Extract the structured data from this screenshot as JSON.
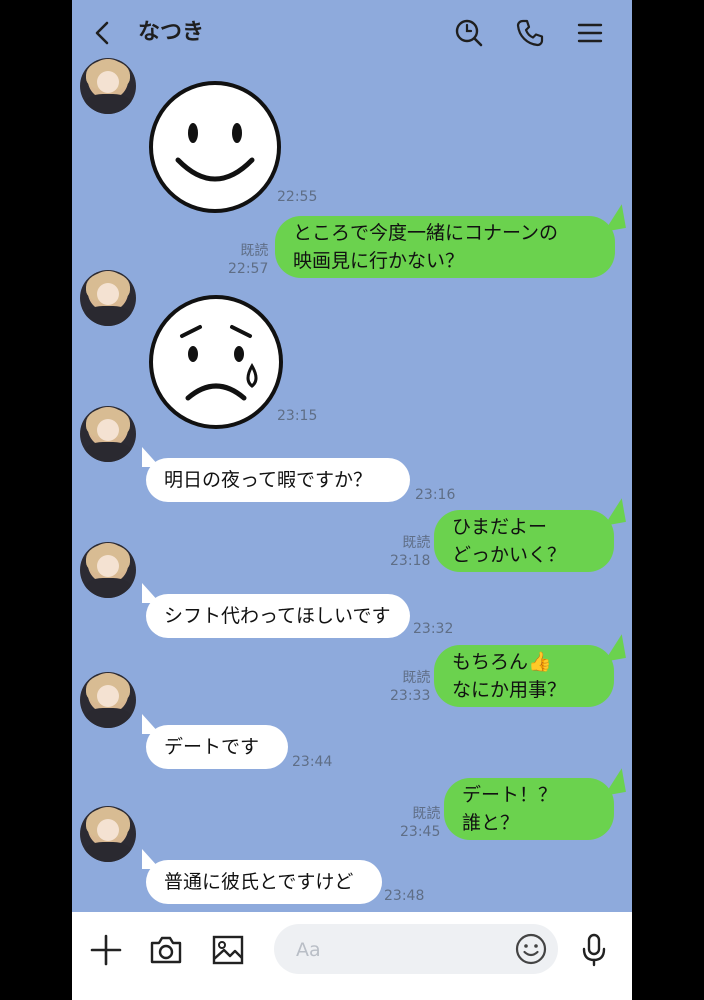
{
  "header": {
    "title": "なつき",
    "icons": [
      "back-chevron-icon",
      "search-icon",
      "phone-icon",
      "menu-icon"
    ]
  },
  "messages": [
    {
      "side": "in",
      "type": "sticker",
      "sticker": "smiling-face",
      "time": "22:55"
    },
    {
      "side": "out",
      "type": "text",
      "lines": [
        "ところで今度一緒にコナーンの",
        "映画見に行かない？"
      ],
      "read": "既読",
      "time": "22:57"
    },
    {
      "side": "in",
      "type": "sticker",
      "sticker": "crying-face",
      "time": "23:15"
    },
    {
      "side": "in",
      "type": "text",
      "lines": [
        "明日の夜って暇ですか？"
      ],
      "time": "23:16"
    },
    {
      "side": "out",
      "type": "text",
      "lines": [
        "ひまだよー",
        "どっかいく？"
      ],
      "read": "既読",
      "time": "23:18"
    },
    {
      "side": "in",
      "type": "text",
      "lines": [
        "シフト代わってほしいです"
      ],
      "time": "23:32"
    },
    {
      "side": "out",
      "type": "text",
      "lines": [
        "もちろん👍",
        "なにか用事？"
      ],
      "read": "既読",
      "time": "23:33"
    },
    {
      "side": "in",
      "type": "text",
      "lines": [
        "デートです"
      ],
      "time": "23:44"
    },
    {
      "side": "out",
      "type": "text",
      "lines": [
        "デート！？",
        "誰と？"
      ],
      "read": "既読",
      "time": "23:45"
    },
    {
      "side": "in",
      "type": "text",
      "lines": [
        "普通に彼氏とですけど"
      ],
      "time": "23:48"
    }
  ],
  "input": {
    "placeholder": "Aa",
    "icons": [
      "plus-icon",
      "camera-icon",
      "image-icon",
      "emoji-icon",
      "microphone-icon"
    ]
  },
  "colors": {
    "background": "#8eaadc",
    "outgoing_bubble": "#6bd24e",
    "incoming_bubble": "#ffffff"
  }
}
